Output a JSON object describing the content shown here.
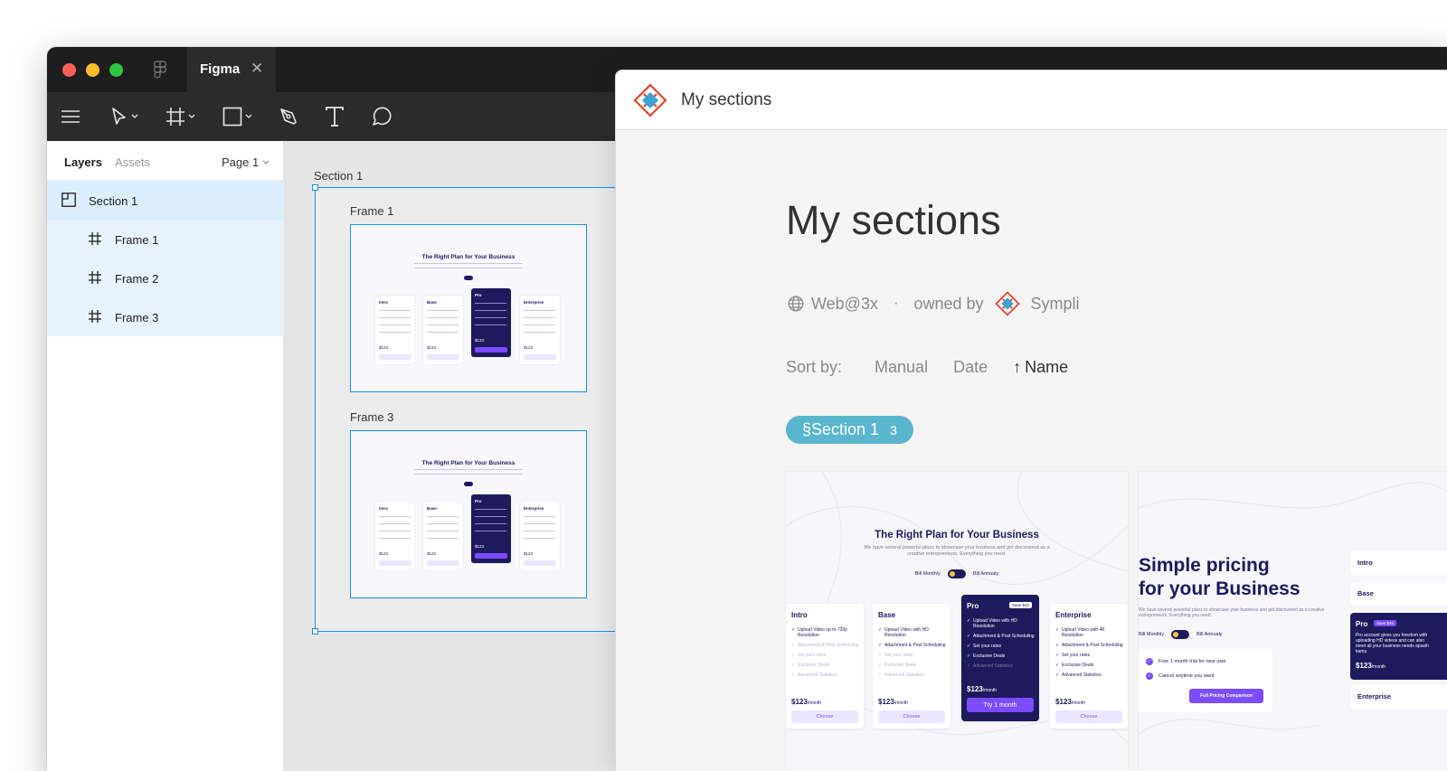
{
  "app": {
    "tab_title": "Figma",
    "tab_close": "✕"
  },
  "toolbar": {
    "menu_icon": "hamburger-icon",
    "move_tool": "cursor-icon",
    "frame_tool": "hash-icon",
    "shape_tool": "rectangle-icon",
    "pen_tool": "pen-icon",
    "text_tool": "text-icon",
    "comment_tool": "comment-icon"
  },
  "layers_panel": {
    "tabs": [
      "Layers",
      "Assets"
    ],
    "page": "Page 1",
    "items": [
      {
        "label": "Section 1",
        "icon": "section-icon"
      },
      {
        "label": "Frame 1",
        "icon": "hash-icon"
      },
      {
        "label": "Frame 2",
        "icon": "hash-icon"
      },
      {
        "label": "Frame 3",
        "icon": "hash-icon"
      }
    ]
  },
  "canvas": {
    "section_label": "Section 1",
    "frames": [
      {
        "label": "Frame 1",
        "mock_title": "The Right Plan for Your Business"
      },
      {
        "label": "Frame 3",
        "mock_title": "The Right Plan for Your Business"
      }
    ]
  },
  "sympli": {
    "header_title": "My sections",
    "page_title": "My sections",
    "meta": {
      "platform": "Web@3x",
      "separator": "•",
      "owned_by": "owned by",
      "owner": "Sympli"
    },
    "sort": {
      "label": "Sort by:",
      "options": [
        "Manual",
        "Date",
        "Name"
      ],
      "active_arrow": "↑"
    },
    "chip": {
      "label": "§Section 1",
      "count": "3"
    },
    "thumb1": {
      "title": "The Right Plan for Your Business",
      "subtitle": "We have several powerful plans to showcase your business and get discovered as a creative entrepreneurs. Everything you need.",
      "toggle_left": "Bill Monthly",
      "toggle_right": "Bill Annualy",
      "cards": [
        {
          "name": "Intro",
          "features": [
            "Upload Video up to 720p Resolution",
            "Attachment & Post Scheduling",
            "Set your rates",
            "Exclusive Deals",
            "Advanced Statistics"
          ],
          "price": "$123",
          "per": "/month",
          "button": "Choose"
        },
        {
          "name": "Base",
          "features": [
            "Upload Video with HD Resolution",
            "Attachment & Post Scheduling",
            "Set your rates",
            "Exclusive Deals",
            "Advanced Statistics"
          ],
          "price": "$123",
          "per": "/month",
          "button": "Choose"
        },
        {
          "name": "Pro",
          "badge": "Save $40",
          "features": [
            "Upload Video with HD Resolution",
            "Attachment & Post Scheduling",
            "Set your rates",
            "Exclusive Deals",
            "Advanced Statistics"
          ],
          "price": "$123",
          "per": "/month",
          "button": "Try 1 month"
        },
        {
          "name": "Enterprise",
          "features": [
            "Upload Video with 4K Resolution",
            "Attachment & Post Scheduling",
            "Set your rates",
            "Exclusive Deals",
            "Advanced Statistics"
          ],
          "price": "$123",
          "per": "/month",
          "button": "Choose"
        }
      ]
    },
    "thumb2": {
      "title_line1": "Simple pricing",
      "title_line2": "for your Business",
      "subtitle": "We have several powerful plans to showcase your business and get discovered as a creative entrepreneurs. Everything you need.",
      "toggle_left": "Bill Monthly",
      "toggle_right": "Bill Annualy",
      "benefits": [
        "Free 1 month trial for new user",
        "Cancel anytime you want"
      ],
      "button": "Full Pricing Comparison",
      "tiers": [
        "Intro",
        "Base",
        "Enterprise"
      ],
      "pro": {
        "name": "Pro",
        "badge": "Save $40",
        "desc": "Pro account gives you freedom with uploading HD videos and can also meet all your business needs apasih kamu",
        "price": "$123",
        "per": "/month"
      }
    }
  },
  "colors": {
    "titlebar": "#1e1e1e",
    "toolbar": "#2c2c2c",
    "selection": "#1b8ef2",
    "chip": "#5ab5cf",
    "navy": "#1d1a5e",
    "purple": "#7b4dff"
  }
}
